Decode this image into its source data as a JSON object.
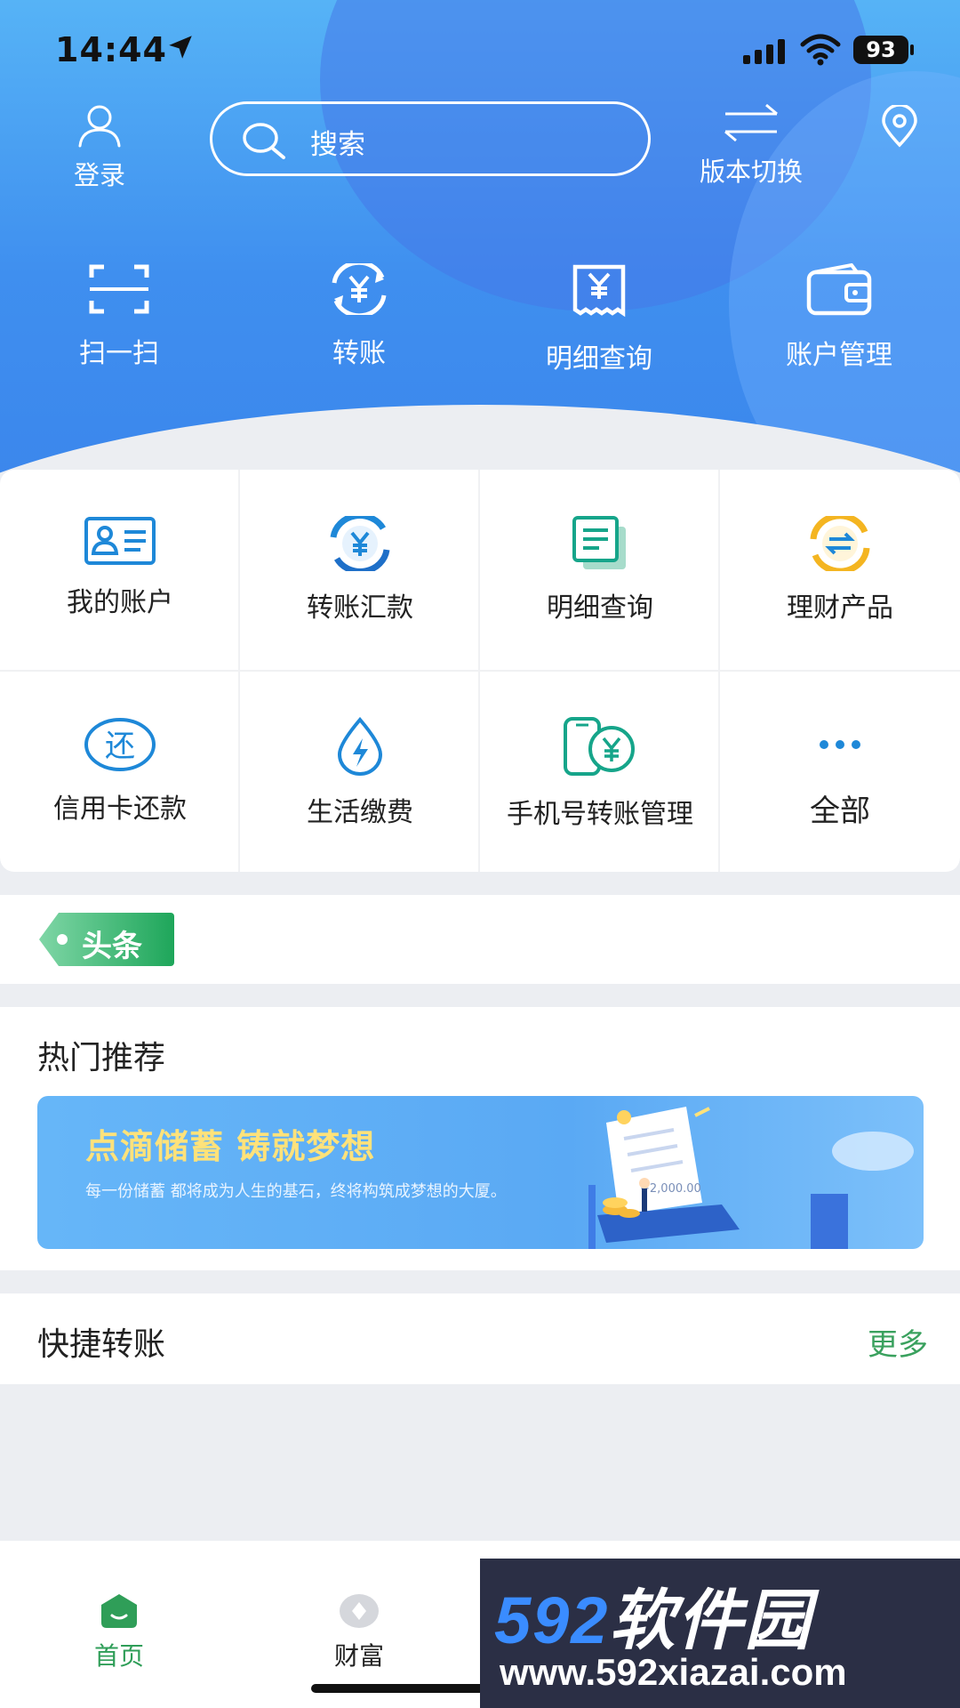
{
  "status_bar": {
    "time": "14:44",
    "battery": "93"
  },
  "header": {
    "login_label": "登录",
    "search_placeholder": "搜索",
    "version_switch_label": "版本切换"
  },
  "quick_actions": [
    {
      "label": "扫一扫",
      "icon": "scan-icon"
    },
    {
      "label": "转账",
      "icon": "transfer-yuan-icon"
    },
    {
      "label": "明细查询",
      "icon": "receipt-icon"
    },
    {
      "label": "账户管理",
      "icon": "wallet-icon"
    }
  ],
  "services": [
    {
      "label": "我的账户",
      "icon": "id-card-icon"
    },
    {
      "label": "转账汇款",
      "icon": "transfer-yuan-icon"
    },
    {
      "label": "明细查询",
      "icon": "document-icon"
    },
    {
      "label": "理财产品",
      "icon": "exchange-icon"
    },
    {
      "label": "信用卡还款",
      "icon": "repay-icon"
    },
    {
      "label": "生活缴费",
      "icon": "utility-drop-icon"
    },
    {
      "label": "手机号转账管理",
      "icon": "phone-transfer-icon"
    },
    {
      "label": "全部",
      "icon": "more-dots-icon"
    }
  ],
  "headline_tag": "头条",
  "hot": {
    "title": "热门推荐",
    "banner_title": "点滴储蓄 铸就梦想",
    "banner_subtitle": "每一份储蓄 都将成为人生的基石，终将构筑成梦想的大厦。",
    "banner_amount": "+2,000.00"
  },
  "quick_transfer": {
    "title": "快捷转账",
    "more": "更多"
  },
  "bottom_nav": [
    {
      "label": "首页",
      "active": true
    },
    {
      "label": "财富",
      "active": false
    }
  ],
  "watermark": {
    "logo_num": "592",
    "logo_cn": "软件园",
    "url": "www.592xiazai.com"
  },
  "colors": {
    "header_blue": "#3f8fef",
    "accent_green": "#2f9e58",
    "more_green": "#3aa15e"
  }
}
